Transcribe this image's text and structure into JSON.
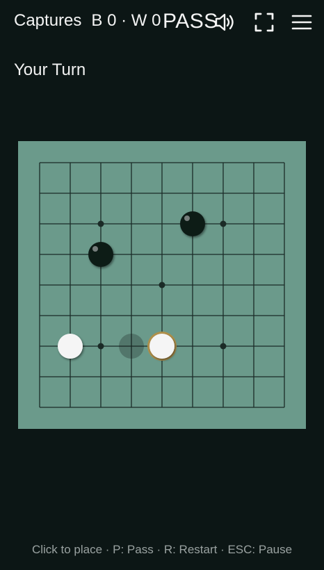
{
  "header": {
    "captures_label": "Captures",
    "black_captures": "B 0",
    "separator": "·",
    "white_captures": "W 0",
    "pass_label": "PASS",
    "sound_icon": "speaker-icon",
    "fullscreen_icon": "fullscreen-icon",
    "menu_icon": "hamburger-menu-icon"
  },
  "status": {
    "turn_text": "Your Turn"
  },
  "board": {
    "size": 9,
    "colors": {
      "board": "#6b9a8b",
      "lines": "#1b2b27",
      "black_stone": "#111a18",
      "white_stone": "#f5f5f5",
      "last_move_ring": "#b0904a"
    },
    "star_points": [
      [
        2,
        2
      ],
      [
        6,
        2
      ],
      [
        4,
        4
      ],
      [
        2,
        6
      ],
      [
        6,
        6
      ]
    ],
    "stones": [
      {
        "color": "black",
        "col": 5,
        "row": 2
      },
      {
        "color": "black",
        "col": 2,
        "row": 3
      },
      {
        "color": "white",
        "col": 1,
        "row": 6
      },
      {
        "color": "white",
        "col": 4,
        "row": 6,
        "last_move": true
      }
    ],
    "hover_preview": {
      "color": "black",
      "col": 3,
      "row": 6
    }
  },
  "footer": {
    "hint": "Click to place · P: Pass · R: Restart · ESC: Pause"
  }
}
